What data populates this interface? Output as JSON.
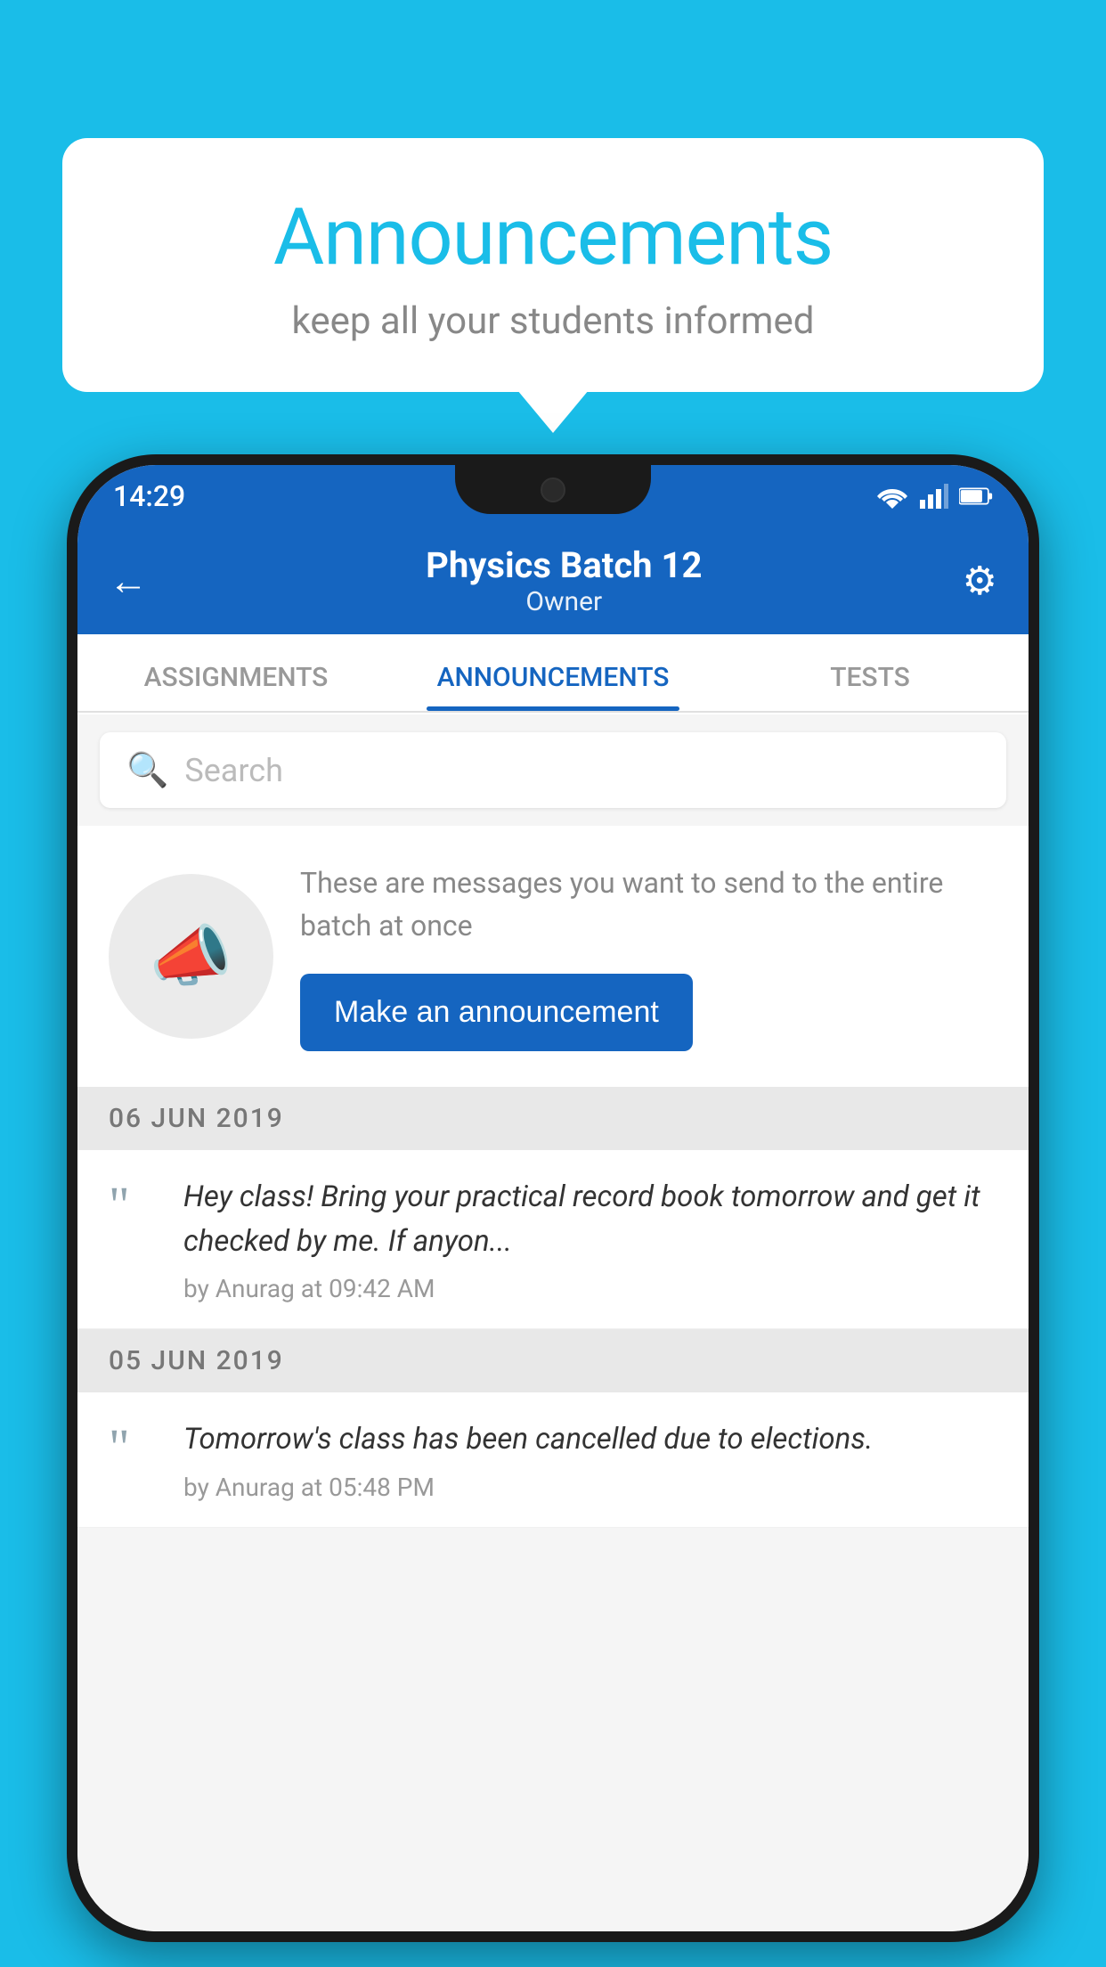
{
  "bubble": {
    "title": "Announcements",
    "subtitle": "keep all your students informed"
  },
  "status_bar": {
    "time": "14:29",
    "wifi": "wifi",
    "signal": "signal",
    "battery": "battery"
  },
  "header": {
    "title": "Physics Batch 12",
    "subtitle": "Owner",
    "back_label": "←",
    "settings_label": "⚙"
  },
  "tabs": [
    {
      "label": "ASSIGNMENTS",
      "active": false
    },
    {
      "label": "ANNOUNCEMENTS",
      "active": true
    },
    {
      "label": "TESTS",
      "active": false
    }
  ],
  "search": {
    "placeholder": "Search"
  },
  "announcement_card": {
    "description": "These are messages you want to send to the entire batch at once",
    "button_label": "Make an announcement"
  },
  "announcements": [
    {
      "date": "06  JUN  2019",
      "text": "Hey class! Bring your practical record book tomorrow and get it checked by me. If anyon...",
      "meta": "by Anurag at 09:42 AM"
    },
    {
      "date": "05  JUN  2019",
      "text": "Tomorrow's class has been cancelled due to elections.",
      "meta": "by Anurag at 05:48 PM"
    }
  ]
}
